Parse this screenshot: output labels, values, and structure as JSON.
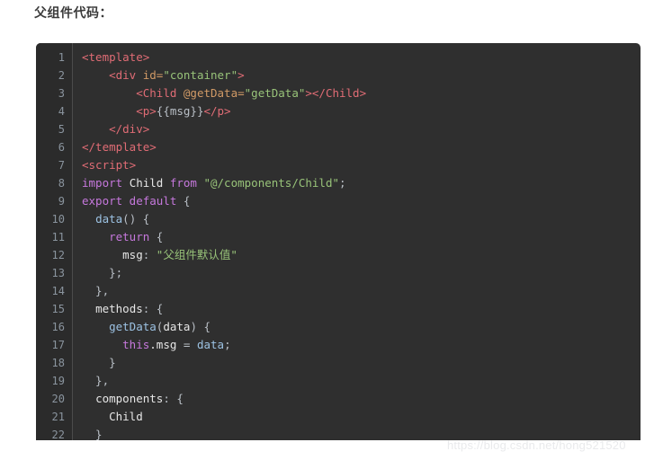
{
  "page": {
    "heading": "父组件代码：",
    "watermark": "https://blog.csdn.net/hong521520",
    "background_color": "#ffffff"
  },
  "code_block": {
    "language": "vue",
    "theme": "dark",
    "background_color": "#2f2f2f",
    "gutter_background_color": "#2b2b2b",
    "line_number_color": "#8a949e",
    "text_color": "#d7dae0",
    "first_visible_line": 1,
    "last_visible_line": 22,
    "clipped_at_bottom": true,
    "line_numbers": [
      "1",
      "2",
      "3",
      "4",
      "5",
      "6",
      "7",
      "8",
      "9",
      "10",
      "11",
      "12",
      "13",
      "14",
      "15",
      "16",
      "17",
      "18",
      "19",
      "20",
      "21",
      "22"
    ],
    "lines": [
      {
        "n": "1",
        "text": "<template>"
      },
      {
        "n": "2",
        "text": "    <div id=\"container\">"
      },
      {
        "n": "3",
        "text": "        <Child @getData=\"getData\"></Child>"
      },
      {
        "n": "4",
        "text": "        <p>{{msg}}</p>"
      },
      {
        "n": "5",
        "text": "    </div>"
      },
      {
        "n": "6",
        "text": "</template>"
      },
      {
        "n": "7",
        "text": "<script>"
      },
      {
        "n": "8",
        "text": "import Child from \"@/components/Child\";"
      },
      {
        "n": "9",
        "text": "export default {"
      },
      {
        "n": "10",
        "text": "  data() {"
      },
      {
        "n": "11",
        "text": "    return {"
      },
      {
        "n": "12",
        "text": "      msg: \"父组件默认值\""
      },
      {
        "n": "13",
        "text": "    };"
      },
      {
        "n": "14",
        "text": "  },"
      },
      {
        "n": "15",
        "text": "  methods: {"
      },
      {
        "n": "16",
        "text": "    getData(data) {"
      },
      {
        "n": "17",
        "text": "      this.msg = data;"
      },
      {
        "n": "18",
        "text": "    }"
      },
      {
        "n": "19",
        "text": "  },"
      },
      {
        "n": "20",
        "text": "  components: {"
      },
      {
        "n": "21",
        "text": "    Child"
      },
      {
        "n": "22",
        "text": "  }"
      }
    ],
    "tokens": {
      "l1": {
        "a": "<template>"
      },
      "l2": {
        "a": "    ",
        "b": "<div ",
        "c": "id=",
        "d": "\"container\"",
        "e": ">"
      },
      "l3": {
        "a": "        ",
        "b": "<Child ",
        "c": "@getData=",
        "d": "\"getData\"",
        "e": ">",
        "f": "</Child>"
      },
      "l4": {
        "a": "        ",
        "b": "<p>",
        "c": "{{msg}}",
        "d": "</p>"
      },
      "l5": {
        "a": "    ",
        "b": "</div>"
      },
      "l6": {
        "a": "</template>"
      },
      "l7": {
        "a": "<script>"
      },
      "l8": {
        "a": "import ",
        "b": "Child ",
        "c": "from ",
        "d": "\"@/components/Child\"",
        "e": ";"
      },
      "l9": {
        "a": "export default ",
        "b": "{"
      },
      "l10": {
        "a": "  ",
        "b": "data",
        "c": "() {"
      },
      "l11": {
        "a": "    ",
        "b": "return ",
        "c": "{"
      },
      "l12": {
        "a": "      ",
        "b": "msg",
        "c": ": ",
        "d": "\"父组件默认值\""
      },
      "l13": {
        "a": "    };"
      },
      "l14": {
        "a": "  },"
      },
      "l15": {
        "a": "  ",
        "b": "methods",
        "c": ": {"
      },
      "l16": {
        "a": "    ",
        "b": "getData",
        "c": "(",
        "d": "data",
        "e": ") {"
      },
      "l17": {
        "a": "      ",
        "b": "this",
        "c": ".msg ",
        "d": "= ",
        "e": "data",
        "f": ";"
      },
      "l18": {
        "a": "    }"
      },
      "l19": {
        "a": "  },"
      },
      "l20": {
        "a": "  ",
        "b": "components",
        "c": ": {"
      },
      "l21": {
        "a": "    ",
        "b": "Child"
      },
      "l22": {
        "a": "  }"
      }
    }
  }
}
